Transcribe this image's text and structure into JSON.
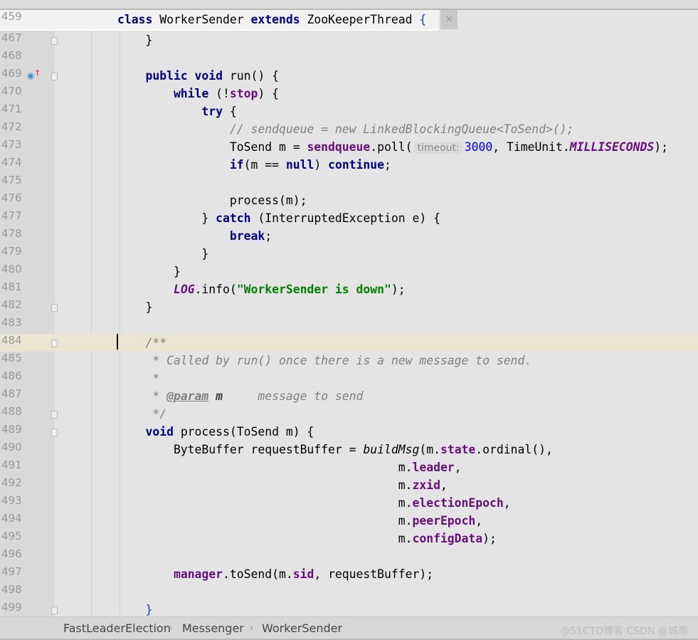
{
  "sticky_header": {
    "line": "459",
    "tokens": [
      [
        "class ",
        "kw"
      ],
      [
        "WorkerSender ",
        ""
      ],
      [
        "extends ",
        "kw"
      ],
      [
        "ZooKeeperThread ",
        ""
      ],
      [
        "{",
        "br"
      ]
    ],
    "close": "×"
  },
  "lines": [
    {
      "n": "467",
      "fold": true,
      "tokens": [
        [
          "    }",
          ""
        ]
      ]
    },
    {
      "n": "468",
      "tokens": []
    },
    {
      "n": "469",
      "fold": true,
      "icon": "override-method-icon",
      "tokens": [
        [
          "    public void ",
          "kw"
        ],
        [
          "run() {",
          ""
        ]
      ]
    },
    {
      "n": "470",
      "tokens": [
        [
          "        while ",
          "kw"
        ],
        [
          "(!",
          ""
        ],
        [
          "stop",
          "fd"
        ],
        [
          ") {",
          ""
        ]
      ]
    },
    {
      "n": "471",
      "tokens": [
        [
          "            try ",
          "kw"
        ],
        [
          "{",
          ""
        ]
      ]
    },
    {
      "n": "472",
      "tokens": [
        [
          "                // sendqueue = new LinkedBlockingQueue<ToSend>();",
          "cm"
        ]
      ]
    },
    {
      "n": "473",
      "tokens": [
        [
          "                ToSend m = ",
          ""
        ],
        [
          "sendqueue",
          "fd"
        ],
        [
          ".poll(",
          ""
        ],
        [
          "timeout:",
          "hint"
        ],
        [
          "3000",
          "num"
        ],
        [
          ", TimeUnit.",
          ""
        ],
        [
          "MILLISECONDS",
          "st"
        ],
        [
          ");",
          ""
        ]
      ]
    },
    {
      "n": "474",
      "tokens": [
        [
          "                if",
          "kw"
        ],
        [
          "(m == ",
          ""
        ],
        [
          "null",
          "kw"
        ],
        [
          ") ",
          ""
        ],
        [
          "continue",
          "kw"
        ],
        [
          ";",
          ""
        ]
      ]
    },
    {
      "n": "475",
      "tokens": []
    },
    {
      "n": "476",
      "tokens": [
        [
          "                process(m);",
          ""
        ]
      ]
    },
    {
      "n": "477",
      "tokens": [
        [
          "            } ",
          ""
        ],
        [
          "catch ",
          "kw"
        ],
        [
          "(InterruptedException e) {",
          ""
        ]
      ]
    },
    {
      "n": "478",
      "tokens": [
        [
          "                break",
          "kw"
        ],
        [
          ";",
          ""
        ]
      ]
    },
    {
      "n": "479",
      "tokens": [
        [
          "            }",
          ""
        ]
      ]
    },
    {
      "n": "480",
      "tokens": [
        [
          "        }",
          ""
        ]
      ]
    },
    {
      "n": "481",
      "tokens": [
        [
          "        ",
          ""
        ],
        [
          "LOG",
          "st"
        ],
        [
          ".info(",
          ""
        ],
        [
          "\"WorkerSender is down\"",
          "str"
        ],
        [
          ");",
          ""
        ]
      ]
    },
    {
      "n": "482",
      "fold": true,
      "tokens": [
        [
          "    }",
          ""
        ]
      ]
    },
    {
      "n": "483",
      "tokens": []
    },
    {
      "n": "484",
      "fold": true,
      "highlight": true,
      "tokens": [
        [
          "    /**",
          "cm"
        ]
      ]
    },
    {
      "n": "485",
      "tokens": [
        [
          "     * Called by run() once there is a new message to send.",
          "cm"
        ]
      ]
    },
    {
      "n": "486",
      "tokens": [
        [
          "     *",
          "cm"
        ]
      ]
    },
    {
      "n": "487",
      "tokens": [
        [
          "     * ",
          "cm"
        ],
        [
          "@param",
          "tag"
        ],
        [
          " ",
          "cm"
        ],
        [
          "m",
          "tagv"
        ],
        [
          "     message to send",
          "cm"
        ]
      ]
    },
    {
      "n": "488",
      "fold": true,
      "tokens": [
        [
          "     */",
          "cm"
        ]
      ]
    },
    {
      "n": "489",
      "fold": true,
      "tokens": [
        [
          "    void ",
          "kw"
        ],
        [
          "process(ToSend m) {",
          ""
        ]
      ]
    },
    {
      "n": "490",
      "tokens": [
        [
          "        ByteBuffer requestBuffer = ",
          ""
        ],
        [
          "buildMsg",
          "it"
        ],
        [
          "(m.",
          ""
        ],
        [
          "state",
          "fd"
        ],
        [
          ".ordinal(),",
          ""
        ]
      ]
    },
    {
      "n": "491",
      "tokens": [
        [
          "                                        m.",
          ""
        ],
        [
          "leader",
          "fd"
        ],
        [
          ",",
          ""
        ]
      ]
    },
    {
      "n": "492",
      "tokens": [
        [
          "                                        m.",
          ""
        ],
        [
          "zxid",
          "fd"
        ],
        [
          ",",
          ""
        ]
      ]
    },
    {
      "n": "493",
      "tokens": [
        [
          "                                        m.",
          ""
        ],
        [
          "electionEpoch",
          "fd"
        ],
        [
          ",",
          ""
        ]
      ]
    },
    {
      "n": "494",
      "tokens": [
        [
          "                                        m.",
          ""
        ],
        [
          "peerEpoch",
          "fd"
        ],
        [
          ",",
          ""
        ]
      ]
    },
    {
      "n": "495",
      "tokens": [
        [
          "                                        m.",
          ""
        ],
        [
          "configData",
          "fd"
        ],
        [
          ");",
          ""
        ]
      ]
    },
    {
      "n": "496",
      "tokens": []
    },
    {
      "n": "497",
      "tokens": [
        [
          "        ",
          ""
        ],
        [
          "manager",
          "fd"
        ],
        [
          ".toSend(m.",
          ""
        ],
        [
          "sid",
          "fd"
        ],
        [
          ", requestBuffer);",
          ""
        ]
      ]
    },
    {
      "n": "498",
      "tokens": []
    },
    {
      "n": "499",
      "fold": true,
      "tokens": [
        [
          "    }",
          "br"
        ]
      ]
    }
  ],
  "breadcrumb": [
    "FastLeaderElection",
    "Messenger",
    "WorkerSender"
  ],
  "breadcrumb_sep": "›",
  "watermark": "@51CTO博客 CSDN @城南"
}
